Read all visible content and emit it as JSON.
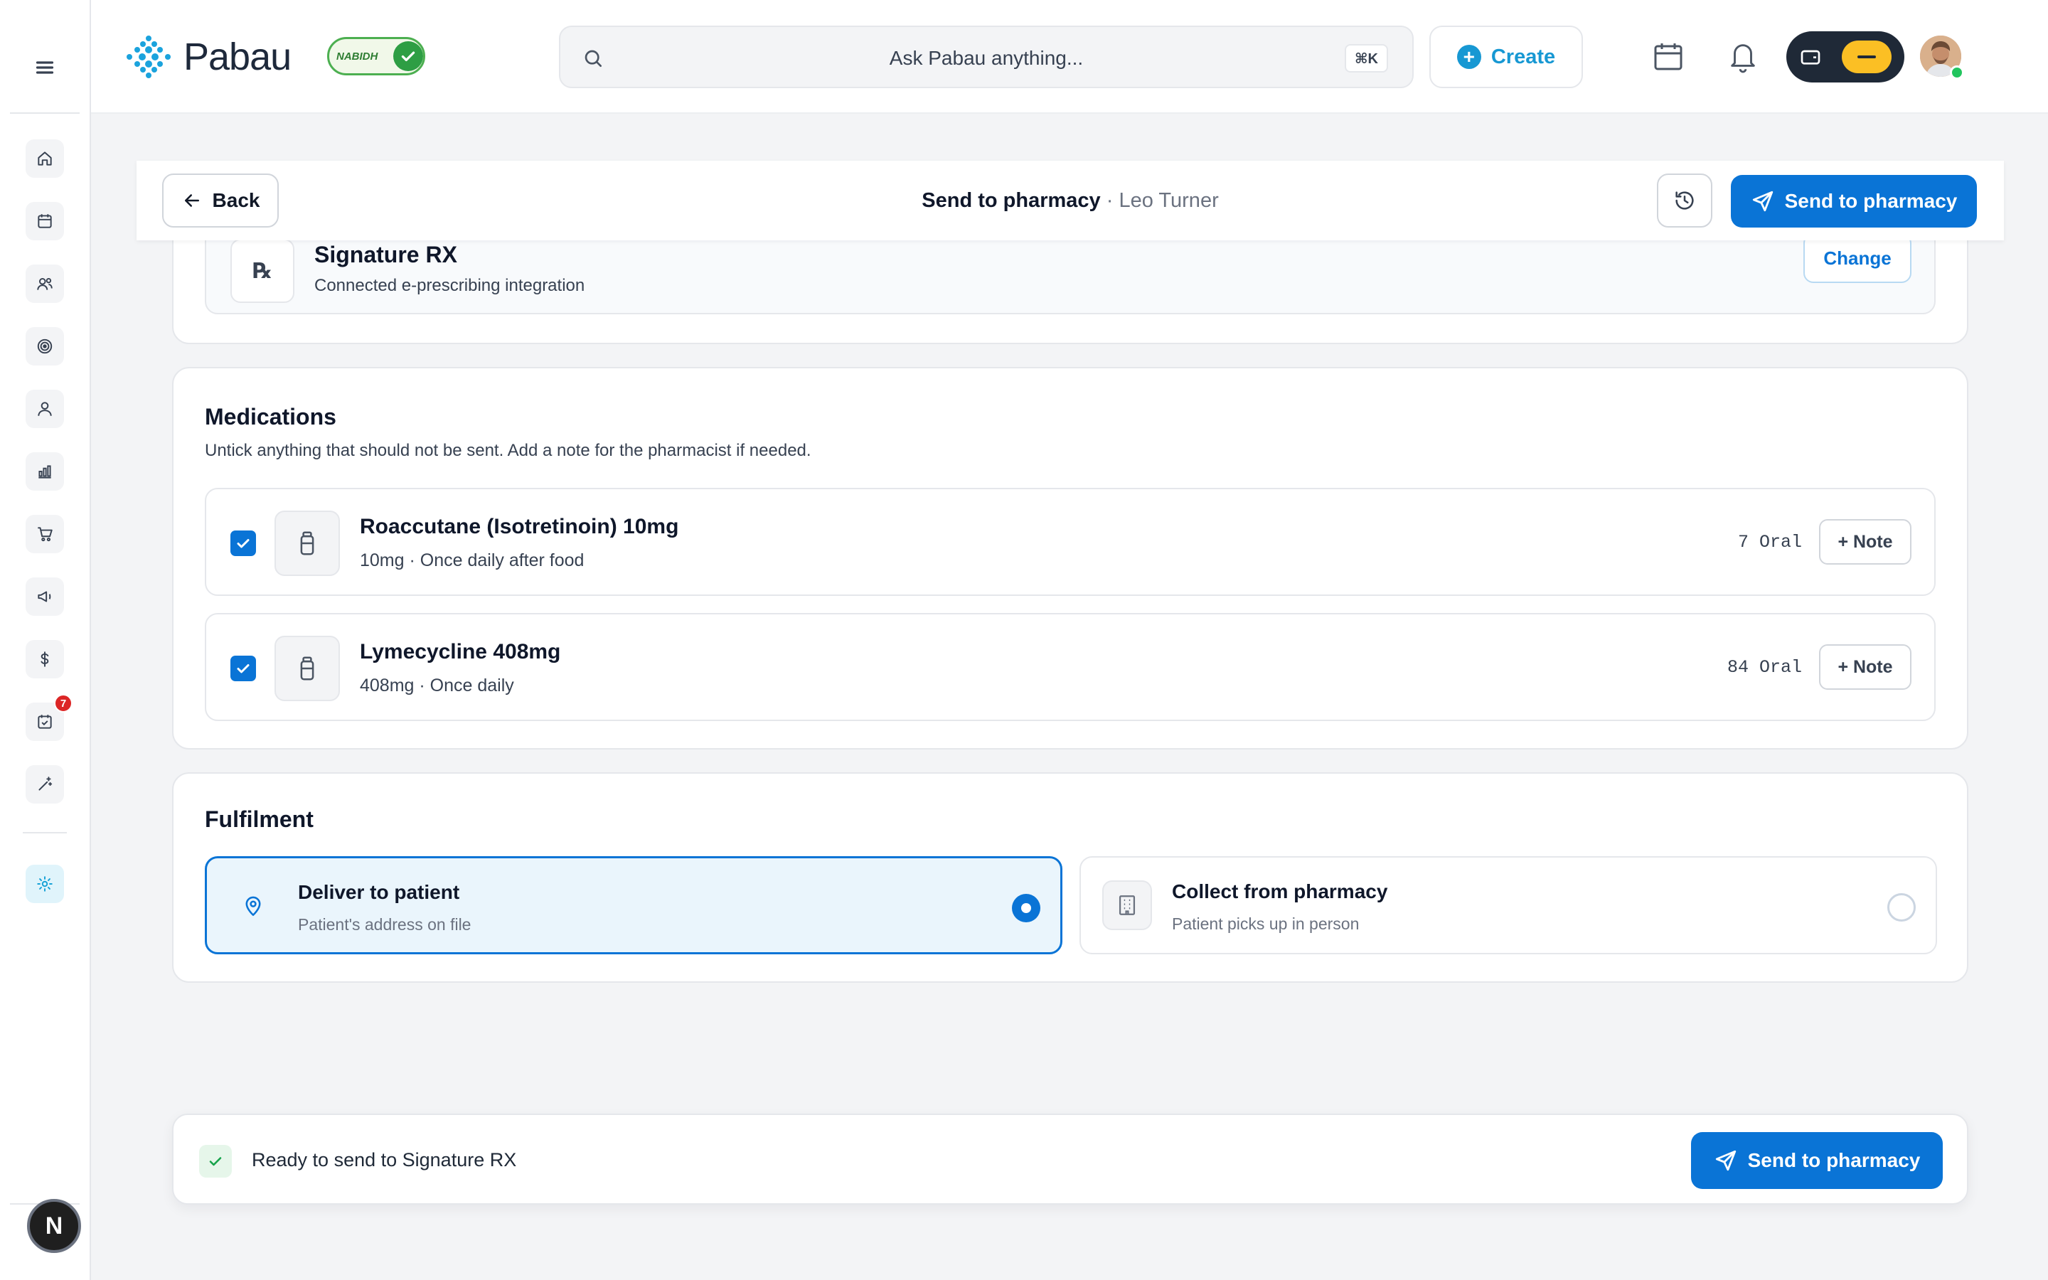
{
  "app": {
    "name": "Pabau",
    "badge_text": "NABIDH"
  },
  "search": {
    "placeholder": "Ask Pabau anything...",
    "shortcut": "⌘K"
  },
  "topbar": {
    "create_label": "Create"
  },
  "sidebar": {
    "items": [
      {
        "icon": "home-icon"
      },
      {
        "icon": "calendar-icon"
      },
      {
        "icon": "clients-icon"
      },
      {
        "icon": "target-icon"
      },
      {
        "icon": "user-icon"
      },
      {
        "icon": "reports-icon"
      },
      {
        "icon": "cart-icon"
      },
      {
        "icon": "megaphone-icon"
      },
      {
        "icon": "dollar-icon"
      },
      {
        "icon": "tasks-icon",
        "badge": "7"
      },
      {
        "icon": "magic-wand-icon"
      },
      {
        "icon": "settings-icon",
        "active": true
      }
    ],
    "bottom_avatar": "N"
  },
  "header": {
    "back_label": "Back",
    "title": "Send to pharmacy",
    "separator": "·",
    "patient": "Leo Turner",
    "send_label": "Send to pharmacy"
  },
  "provider": {
    "rx_symbol": "℞",
    "name": "Signature RX",
    "subtitle": "Connected e-prescribing integration",
    "change_label": "Change"
  },
  "medications": {
    "title": "Medications",
    "subtitle": "Untick anything that should not be sent. Add a note for the pharmacist if needed.",
    "items": [
      {
        "name": "Roaccutane (Isotretinoin) 10mg",
        "detail": "10mg · Once daily after food",
        "meta": "7 Oral",
        "note_label": "+ Note",
        "checked": true
      },
      {
        "name": "Lymecycline 408mg",
        "detail": "408mg · Once daily",
        "meta": "84 Oral",
        "note_label": "+ Note",
        "checked": true
      }
    ]
  },
  "fulfilment": {
    "title": "Fulfilment",
    "options": [
      {
        "title": "Deliver to patient",
        "subtitle": "Patient's address on file",
        "selected": true
      },
      {
        "title": "Collect from pharmacy",
        "subtitle": "Patient picks up in person",
        "selected": false
      }
    ]
  },
  "footer": {
    "status_text": "Ready to send to Signature RX",
    "send_label": "Send to pharmacy"
  },
  "colors": {
    "primary": "#0a74d6",
    "brand": "#1798d3",
    "success": "#16a34a",
    "badge": "#dc2626"
  }
}
